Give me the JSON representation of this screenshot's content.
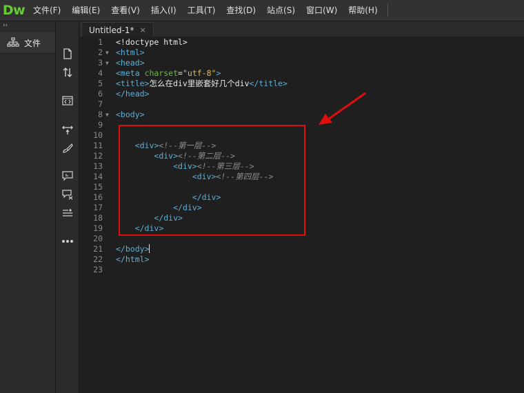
{
  "app": {
    "logo": "Dw"
  },
  "menu": [
    "文件(F)",
    "编辑(E)",
    "查看(V)",
    "插入(I)",
    "工具(T)",
    "查找(D)",
    "站点(S)",
    "窗口(W)",
    "帮助(H)"
  ],
  "sidebar": {
    "files_label": "文件"
  },
  "tabs": [
    {
      "label": "Untitled-1*",
      "close": "×"
    }
  ],
  "editor": {
    "lines": [
      {
        "n": "1",
        "fold": "",
        "html": "<span class=\"txt\">&lt;!doctype html&gt;</span>"
      },
      {
        "n": "2",
        "fold": "▼",
        "html": "<span class=\"tag\">&lt;html&gt;</span>"
      },
      {
        "n": "3",
        "fold": "▼",
        "html": "<span class=\"tag\">&lt;head&gt;</span>"
      },
      {
        "n": "4",
        "fold": "",
        "html": "<span class=\"tag\">&lt;meta</span> <span class=\"attr\">charset</span><span class=\"txt\">=</span><span class=\"str\">\"utf-8\"</span><span class=\"tag\">&gt;</span>"
      },
      {
        "n": "5",
        "fold": "",
        "html": "<span class=\"tag\">&lt;title&gt;</span><span class=\"txt\">怎么在div里嵌套好几个div</span><span class=\"tag\">&lt;/title&gt;</span>"
      },
      {
        "n": "6",
        "fold": "",
        "html": "<span class=\"tag\">&lt;/head&gt;</span>"
      },
      {
        "n": "7",
        "fold": "",
        "html": ""
      },
      {
        "n": "8",
        "fold": "▼",
        "html": "<span class=\"tag\">&lt;body&gt;</span>"
      },
      {
        "n": "9",
        "fold": "",
        "html": ""
      },
      {
        "n": "10",
        "fold": "",
        "html": ""
      },
      {
        "n": "11",
        "fold": "",
        "html": "    <span class=\"tag\">&lt;div&gt;</span><span class=\"cmt\">&lt;!--第一层--&gt;</span>"
      },
      {
        "n": "12",
        "fold": "",
        "html": "        <span class=\"tag\">&lt;div&gt;</span><span class=\"cmt\">&lt;!--第二层--&gt;</span>"
      },
      {
        "n": "13",
        "fold": "",
        "html": "            <span class=\"tag\">&lt;div&gt;</span><span class=\"cmt\">&lt;!--第三层--&gt;</span>"
      },
      {
        "n": "14",
        "fold": "",
        "html": "                <span class=\"tag\">&lt;div&gt;</span><span class=\"cmt\">&lt;!--第四层--&gt;</span>"
      },
      {
        "n": "15",
        "fold": "",
        "html": ""
      },
      {
        "n": "16",
        "fold": "",
        "html": "                <span class=\"tag\">&lt;/div&gt;</span>"
      },
      {
        "n": "17",
        "fold": "",
        "html": "            <span class=\"tag\">&lt;/div&gt;</span>"
      },
      {
        "n": "18",
        "fold": "",
        "html": "        <span class=\"tag\">&lt;/div&gt;</span>"
      },
      {
        "n": "19",
        "fold": "",
        "html": "    <span class=\"tag\">&lt;/div&gt;</span>"
      },
      {
        "n": "20",
        "fold": "",
        "html": ""
      },
      {
        "n": "21",
        "fold": "",
        "html": "<span class=\"tag\">&lt;/body&gt;</span><span class=\"cursor\"></span>"
      },
      {
        "n": "22",
        "fold": "",
        "html": "<span class=\"tag\">&lt;/html&gt;</span>"
      },
      {
        "n": "23",
        "fold": "",
        "html": ""
      }
    ]
  },
  "colors": {
    "tag": "#5db0d7",
    "attr": "#6fb94a",
    "string": "#e8b94a",
    "comment": "#8f8f8f",
    "highlight": "#e00d0d",
    "logo": "#66cc33"
  },
  "icons": {
    "toolstrip": [
      "new-document-icon",
      "sort-icon",
      "code-view-icon",
      "expand-icon",
      "paint-icon",
      "comment-icon",
      "comment-remove-icon",
      "format-icon",
      "more-icon"
    ]
  }
}
